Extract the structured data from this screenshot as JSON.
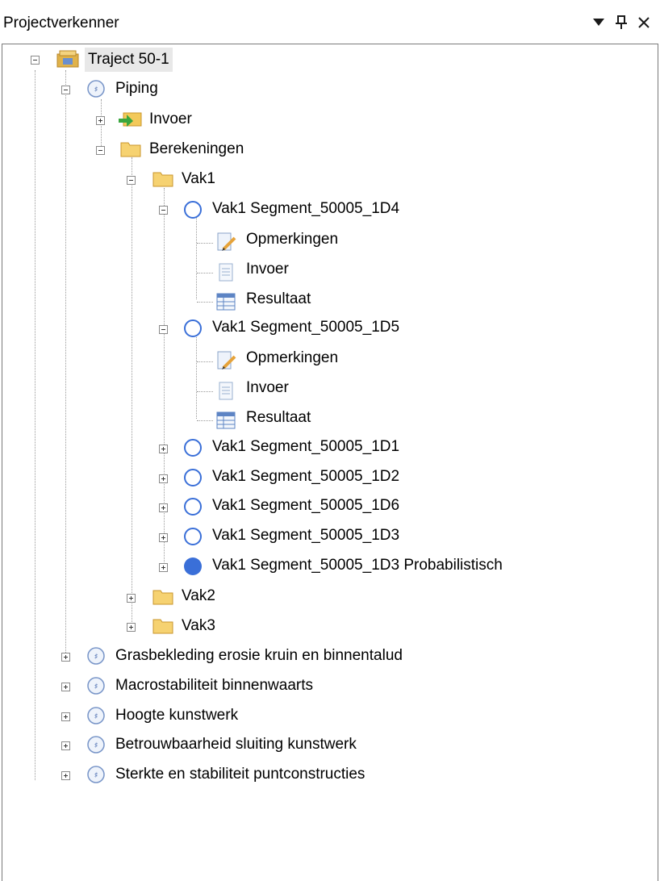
{
  "panel": {
    "title": "Projectverkenner"
  },
  "tree": {
    "root": "Traject 50-1",
    "piping": "Piping",
    "invoer": "Invoer",
    "berekeningen": "Berekeningen",
    "vak1": "Vak1",
    "calc1d4": "Vak1 Segment_50005_1D4",
    "calc1d4_children": [
      "Opmerkingen",
      "Invoer",
      "Resultaat"
    ],
    "calc1d5": "Vak1 Segment_50005_1D5",
    "calc1d5_children": [
      "Opmerkingen",
      "Invoer",
      "Resultaat"
    ],
    "calc1d1": "Vak1 Segment_50005_1D1",
    "calc1d2": "Vak1 Segment_50005_1D2",
    "calc1d6": "Vak1 Segment_50005_1D6",
    "calc1d3": "Vak1 Segment_50005_1D3",
    "calc1d3prob": "Vak1 Segment_50005_1D3 Probabilistisch",
    "vak2": "Vak2",
    "vak3": "Vak3",
    "failure_mechanisms": [
      "Grasbekleding erosie kruin en binnentalud",
      "Macrostabiliteit binnenwaarts",
      "Hoogte kunstwerk",
      "Betrouwbaarheid sluiting kunstwerk",
      "Sterkte en stabiliteit puntconstructies"
    ]
  },
  "colors": {
    "selected_bg": "#e8e8e8",
    "circle": "#3a6fd8",
    "folder": "#f3c95a",
    "arrow": "#4caf50"
  }
}
